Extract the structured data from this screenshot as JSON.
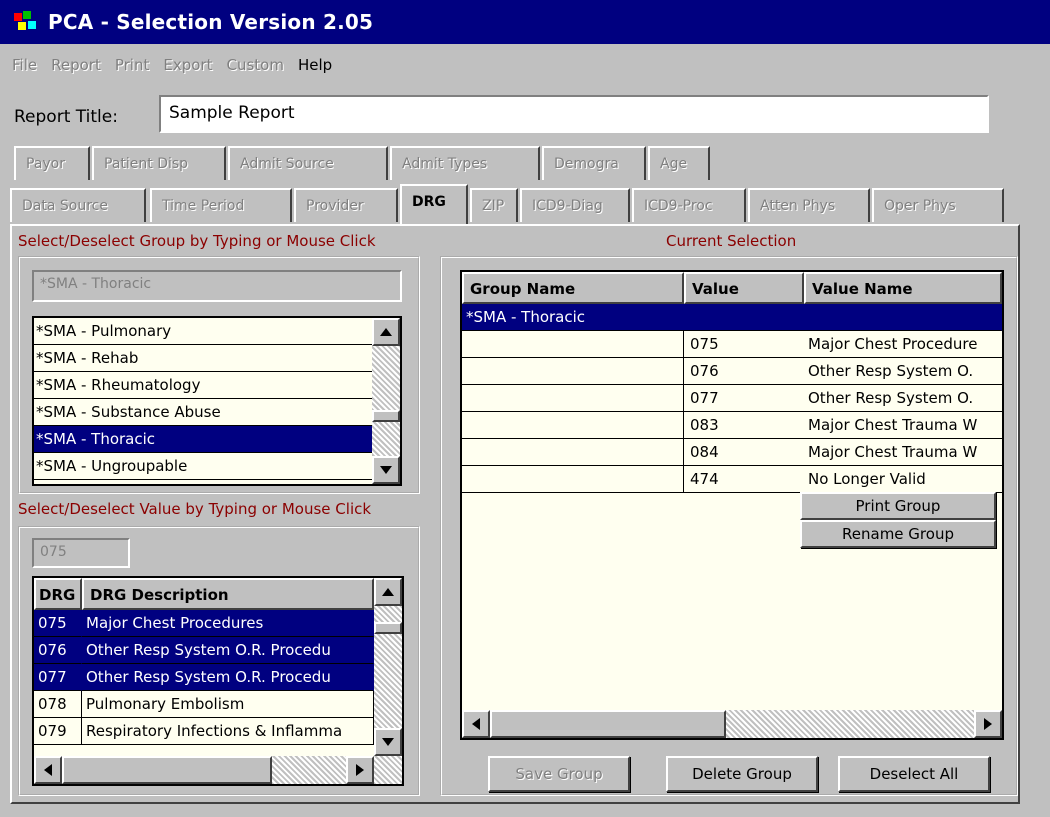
{
  "window": {
    "title": "PCA - Selection Version 2.05"
  },
  "menu": [
    {
      "label": "File",
      "enabled": false
    },
    {
      "label": "Report",
      "enabled": false
    },
    {
      "label": "Print",
      "enabled": false
    },
    {
      "label": "Export",
      "enabled": false
    },
    {
      "label": "Custom",
      "enabled": false
    },
    {
      "label": "Help",
      "enabled": true
    }
  ],
  "report_title": {
    "label": "Report Title:",
    "value": "Sample Report"
  },
  "tabs_row1": [
    "Payor",
    "Patient Disp",
    "Admit Source",
    "Admit Types",
    "Demogra",
    "Age"
  ],
  "tabs_row2": [
    "Data Source",
    "Time Period",
    "Provider",
    "DRG",
    "ZIP",
    "ICD9-Diag",
    "ICD9-Proc",
    "Atten Phys",
    "Oper Phys"
  ],
  "active_tab": "DRG",
  "group_section": {
    "label": "Select/Deselect Group by Typing or Mouse Click",
    "search_value": "*SMA - Thoracic",
    "items": [
      "*SMA - Pulmonary",
      "*SMA - Rehab",
      "*SMA - Rheumatology",
      "*SMA - Substance Abuse",
      "*SMA - Thoracic",
      "*SMA - Ungroupable"
    ],
    "selected_index": 4
  },
  "value_section": {
    "label": "Select/Deselect Value by Typing or Mouse Click",
    "search_value": "075",
    "columns": [
      "DRG",
      "DRG Description"
    ],
    "rows": [
      {
        "code": "075",
        "desc": "Major Chest Procedures",
        "selected": true
      },
      {
        "code": "076",
        "desc": "Other Resp System O.R. Procedu",
        "selected": true
      },
      {
        "code": "077",
        "desc": "Other Resp System O.R. Procedu",
        "selected": true
      },
      {
        "code": "078",
        "desc": "Pulmonary Embolism",
        "selected": false
      },
      {
        "code": "079",
        "desc": "Respiratory Infections & Inflamma",
        "selected": false
      }
    ]
  },
  "current_selection": {
    "label": "Current Selection",
    "columns": [
      "Group Name",
      "Value",
      "Value Name"
    ],
    "group_row": "*SMA - Thoracic",
    "rows": [
      {
        "value": "075",
        "name": "Major Chest Procedure"
      },
      {
        "value": "076",
        "name": "Other Resp System O."
      },
      {
        "value": "077",
        "name": "Other Resp System O."
      },
      {
        "value": "083",
        "name": "Major Chest Trauma W"
      },
      {
        "value": "084",
        "name": "Major Chest Trauma W"
      },
      {
        "value": "474",
        "name": "No Longer Valid"
      }
    ]
  },
  "context_menu": {
    "print_group": "Print Group",
    "rename_group": "Rename Group"
  },
  "buttons": {
    "save_group": "Save Group",
    "delete_group": "Delete Group",
    "deselect_all": "Deselect All"
  }
}
